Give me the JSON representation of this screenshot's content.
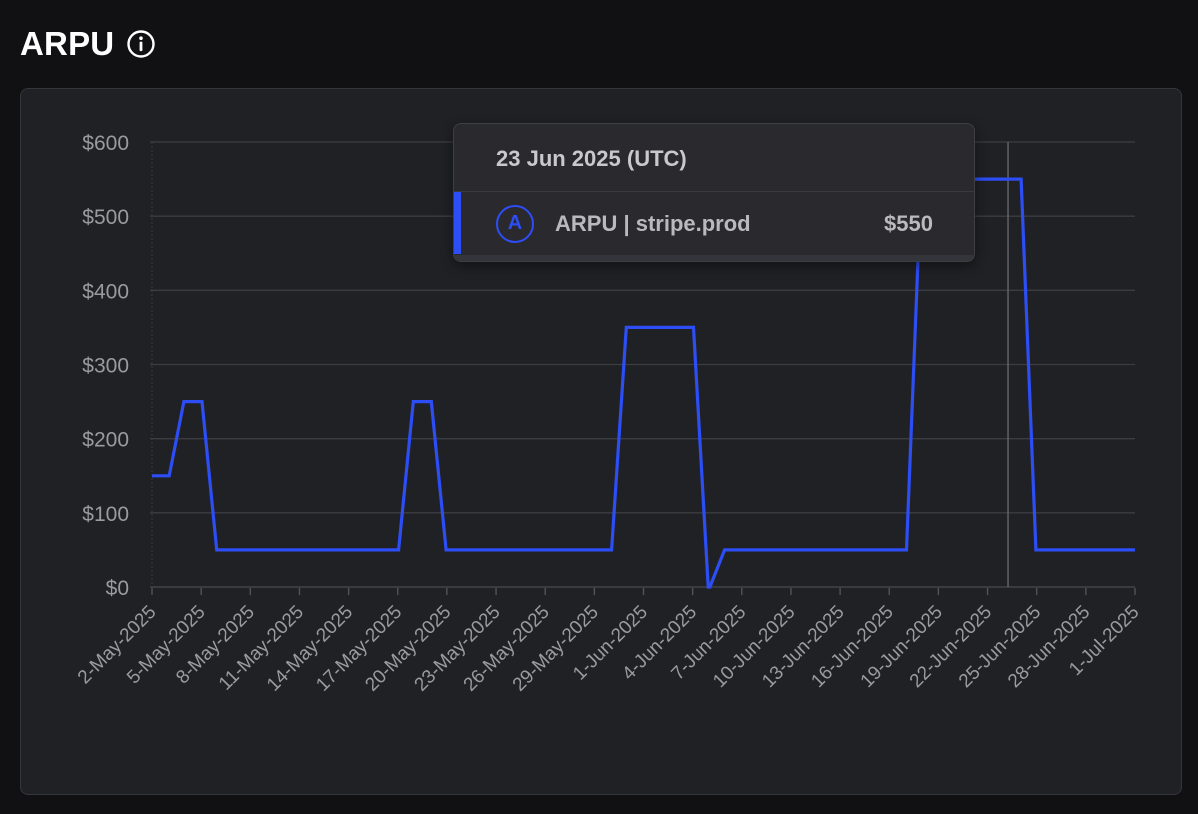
{
  "header": {
    "title": "ARPU",
    "info_icon": "info-icon"
  },
  "tooltip": {
    "date": "23 Jun 2025 (UTC)",
    "series_label": "ARPU | stripe.prod",
    "badge": "A",
    "value": "$550"
  },
  "colors": {
    "line": "#2d4df5",
    "grid": "#3c3d43",
    "tick_label": "#9a9aa0",
    "background": "#202125"
  },
  "chart_data": {
    "type": "line",
    "title": "ARPU",
    "xlabel": "",
    "ylabel": "",
    "ylim": [
      0,
      600
    ],
    "yticks": [
      0,
      100,
      200,
      300,
      400,
      500,
      600
    ],
    "ytick_labels": [
      "$0",
      "$100",
      "$200",
      "$300",
      "$400",
      "$500",
      "$600"
    ],
    "xlim": [
      "2025-05-02",
      "2025-07-01"
    ],
    "xticks": [
      "2025-05-02",
      "2025-05-05",
      "2025-05-08",
      "2025-05-11",
      "2025-05-14",
      "2025-05-17",
      "2025-05-20",
      "2025-05-23",
      "2025-05-26",
      "2025-05-29",
      "2025-06-01",
      "2025-06-04",
      "2025-06-07",
      "2025-06-10",
      "2025-06-13",
      "2025-06-16",
      "2025-06-19",
      "2025-06-22",
      "2025-06-25",
      "2025-06-28",
      "2025-07-01"
    ],
    "xtick_labels": [
      "2-May-2025",
      "5-May-2025",
      "8-May-2025",
      "11-May-2025",
      "14-May-2025",
      "17-May-2025",
      "20-May-2025",
      "23-May-2025",
      "26-May-2025",
      "29-May-2025",
      "1-Jun-2025",
      "4-Jun-2025",
      "7-Jun-2025",
      "10-Jun-2025",
      "13-Jun-2025",
      "16-Jun-2025",
      "19-Jun-2025",
      "22-Jun-2025",
      "25-Jun-2025",
      "28-Jun-2025",
      "1-Jul-2025"
    ],
    "grid": true,
    "legend": "none",
    "hover_date": "2025-06-23",
    "series": [
      {
        "name": "ARPU | stripe.prod",
        "x": [
          "2025-05-02",
          "2025-05-03",
          "2025-05-04",
          "2025-05-05",
          "2025-05-06",
          "2025-05-07",
          "2025-05-08",
          "2025-05-09",
          "2025-05-10",
          "2025-05-11",
          "2025-05-12",
          "2025-05-13",
          "2025-05-14",
          "2025-05-15",
          "2025-05-16",
          "2025-05-17",
          "2025-05-18",
          "2025-05-19",
          "2025-05-20",
          "2025-05-21",
          "2025-05-22",
          "2025-05-23",
          "2025-05-24",
          "2025-05-25",
          "2025-05-26",
          "2025-05-27",
          "2025-05-28",
          "2025-05-29",
          "2025-05-30",
          "2025-05-31",
          "2025-06-01",
          "2025-06-02",
          "2025-06-03",
          "2025-06-04",
          "2025-06-05",
          "2025-06-06",
          "2025-06-07",
          "2025-06-08",
          "2025-06-09",
          "2025-06-10",
          "2025-06-11",
          "2025-06-12",
          "2025-06-13",
          "2025-06-14",
          "2025-06-15",
          "2025-06-16",
          "2025-06-17",
          "2025-06-18",
          "2025-06-19",
          "2025-06-20",
          "2025-06-21",
          "2025-06-22",
          "2025-06-23",
          "2025-06-24",
          "2025-06-25",
          "2025-06-26",
          "2025-06-27",
          "2025-06-28",
          "2025-06-29",
          "2025-06-30",
          "2025-07-01"
        ],
        "y": [
          150,
          150,
          250,
          250,
          50,
          50,
          50,
          50,
          50,
          50,
          50,
          50,
          50,
          50,
          50,
          50,
          250,
          250,
          50,
          50,
          50,
          50,
          50,
          50,
          50,
          50,
          50,
          50,
          50,
          350,
          350,
          350,
          350,
          350,
          0,
          50,
          50,
          50,
          50,
          50,
          50,
          50,
          50,
          50,
          50,
          50,
          50,
          550,
          550,
          550,
          550,
          550,
          550,
          550,
          50,
          50,
          50,
          50,
          50,
          50,
          50
        ]
      }
    ]
  }
}
